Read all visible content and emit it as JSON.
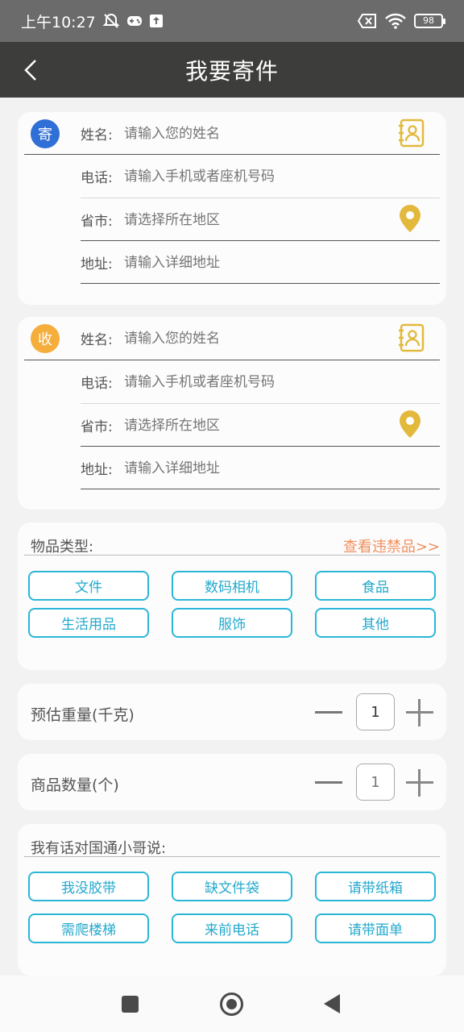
{
  "status_bar": {
    "time": "上午10:27",
    "battery": "98"
  },
  "header": {
    "title": "我要寄件"
  },
  "sender": {
    "badge": "寄",
    "rows": [
      {
        "label": "姓名:",
        "placeholder": "请输入您的姓名"
      },
      {
        "label": "电话:",
        "placeholder": "请输入手机或者座机号码"
      },
      {
        "label": "省市:",
        "placeholder": "请选择所在地区"
      },
      {
        "label": "地址:",
        "placeholder": "请输入详细地址"
      }
    ]
  },
  "receiver": {
    "badge": "收",
    "rows": [
      {
        "label": "姓名:",
        "placeholder": "请输入您的姓名"
      },
      {
        "label": "电话:",
        "placeholder": "请输入手机或者座机号码"
      },
      {
        "label": "省市:",
        "placeholder": "请选择所在地区"
      },
      {
        "label": "地址:",
        "placeholder": "请输入详细地址"
      }
    ]
  },
  "item_type": {
    "title": "物品类型:",
    "prohibited_link": "查看违禁品>>",
    "options": [
      "文件",
      "数码相机",
      "食品",
      "生活用品",
      "服饰",
      "其他"
    ]
  },
  "weight": {
    "label": "预估重量(千克)",
    "value": "1"
  },
  "quantity": {
    "label": "商品数量(个)",
    "value": "1"
  },
  "message": {
    "title": "我有话对国通小哥说:",
    "options": [
      "我没胶带",
      "缺文件袋",
      "请带纸箱",
      "需爬楼梯",
      "来前电话",
      "请带面单"
    ]
  },
  "colors": {
    "accent": "#2bb6d6",
    "sender_badge": "#2f6fd6",
    "receiver_badge": "#f5ad3b",
    "icon_gold": "#e2b93b",
    "link": "#f0905e"
  }
}
